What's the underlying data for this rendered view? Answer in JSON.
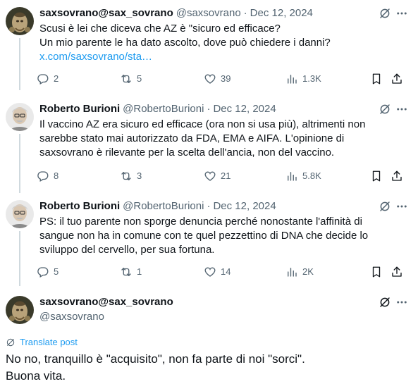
{
  "tweets": [
    {
      "name": "saxsovrano@sax_sovrano",
      "handle": "@saxsovrano",
      "separator": "·",
      "date": "Dec 12, 2024",
      "lines": [
        "Scusi è lei che diceva che AZ è \"sicuro ed efficace?",
        "Un mio parente le ha dato ascolto, dove può chiedere i danni?"
      ],
      "link": "x.com/saxsovrano/sta…",
      "stats": {
        "replies": "2",
        "reposts": "5",
        "likes": "39",
        "views": "1.3K"
      }
    },
    {
      "name": "Roberto Burioni",
      "handle": "@RobertoBurioni",
      "separator": "·",
      "date": "Dec 12, 2024",
      "lines": [
        "Il vaccino AZ era sicuro ed efficace (ora non si usa più), altrimenti non",
        "sarebbe stato mai autorizzato da FDA, EMA e AIFA. L'opinione di",
        "saxsovrano è rilevante per la scelta dell'ancia, non del vaccino."
      ],
      "stats": {
        "replies": "8",
        "reposts": "3",
        "likes": "21",
        "views": "5.8K"
      }
    },
    {
      "name": "Roberto Burioni",
      "handle": "@RobertoBurioni",
      "separator": "·",
      "date": "Dec 12, 2024",
      "lines": [
        "PS: il tuo parente non sporge denuncia perché nonostante l'affinità di",
        "sangue non ha in comune con te quel pezzettino di DNA che decide lo",
        "sviluppo del cervello, per sua fortuna."
      ],
      "stats": {
        "replies": "5",
        "reposts": "1",
        "likes": "14",
        "views": "2K"
      }
    }
  ],
  "main_tweet": {
    "name": "saxsovrano@sax_sovrano",
    "handle": "@saxsovrano",
    "translate_label": "Translate post",
    "lines": [
      "No no, tranquillo è \"acquisito\", non fa parte di noi \"sorci\".",
      "Buona vita."
    ]
  },
  "icons": {
    "reply": "reply-icon",
    "repost": "repost-icon",
    "like": "heart-icon",
    "views": "views-icon",
    "bookmark": "bookmark-icon",
    "share": "share-icon",
    "grok": "grok-icon",
    "more": "more-icon",
    "translate": "globe-icon"
  },
  "colors": {
    "text": "#0f1419",
    "secondary": "#536471",
    "link": "#1d9bf0",
    "line": "#cfd9de"
  }
}
